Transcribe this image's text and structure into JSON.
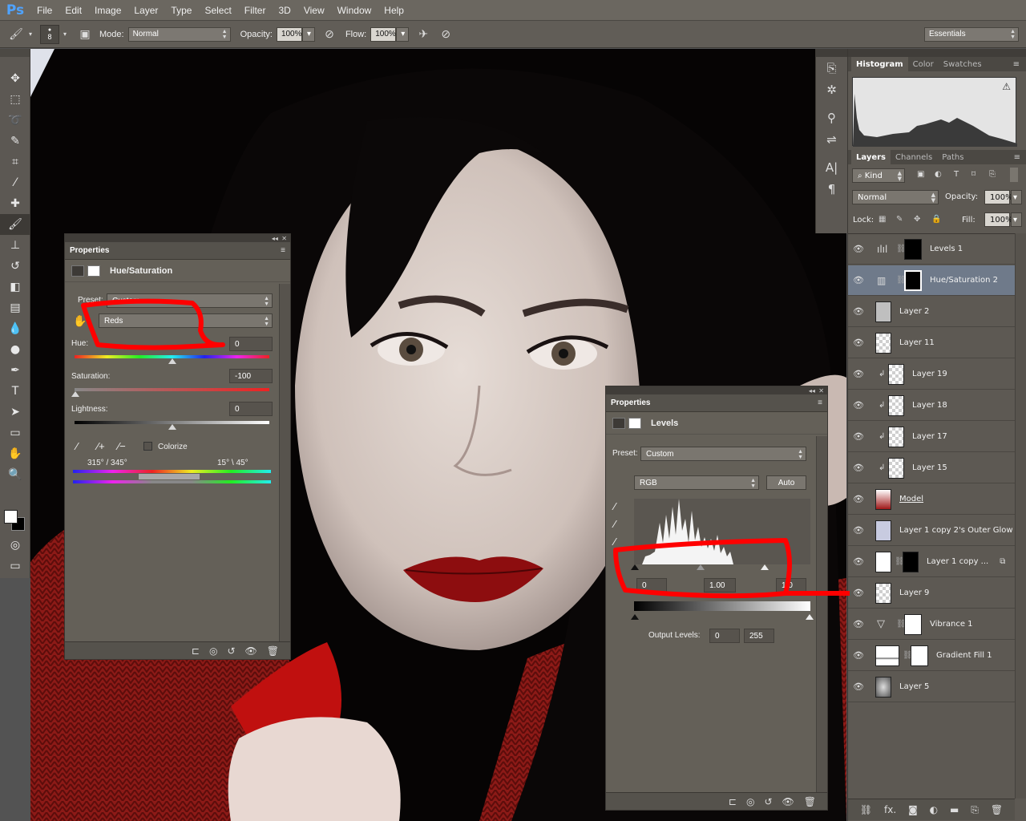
{
  "app": {
    "logo": "Ps"
  },
  "menu": [
    "File",
    "Edit",
    "Image",
    "Layer",
    "Type",
    "Select",
    "Filter",
    "3D",
    "View",
    "Window",
    "Help"
  ],
  "options": {
    "brush_size": "8",
    "mode_label": "Mode:",
    "mode_value": "Normal",
    "opacity_label": "Opacity:",
    "opacity_value": "100%",
    "flow_label": "Flow:",
    "flow_value": "100%",
    "workspace": "Essentials"
  },
  "hue_panel": {
    "title": "Properties",
    "adjustment": "Hue/Saturation",
    "preset_label": "Preset:",
    "preset_value": "Custom",
    "channel_value": "Reds",
    "hue_label": "Hue:",
    "hue_value": "0",
    "saturation_label": "Saturation:",
    "saturation_value": "-100",
    "lightness_label": "Lightness:",
    "lightness_value": "0",
    "colorize_label": "Colorize",
    "range_left": "315° / 345°",
    "range_right": "15° \\ 45°"
  },
  "levels_panel": {
    "title": "Properties",
    "adjustment": "Levels",
    "preset_label": "Preset:",
    "preset_value": "Custom",
    "channel_value": "RGB",
    "auto_label": "Auto",
    "input_black": "0",
    "input_mid": "1.00",
    "input_white": "1.0",
    "output_label": "Output Levels:",
    "output_black": "0",
    "output_white": "255"
  },
  "right_panel": {
    "histogram_tabs": [
      "Histogram",
      "Color",
      "Swatches"
    ],
    "layers_tabs": [
      "Layers",
      "Channels",
      "Paths"
    ],
    "kind_label": "Kind",
    "blend_mode": "Normal",
    "opacity_label": "Opacity:",
    "opacity_value": "100%",
    "lock_label": "Lock:",
    "fill_label": "Fill:",
    "fill_value": "100%"
  },
  "layers": [
    {
      "name": "Levels 1",
      "kind": "adjustment"
    },
    {
      "name": "Hue/Saturation 2",
      "kind": "adjustment",
      "selected": true
    },
    {
      "name": "Layer 2",
      "kind": "pixel"
    },
    {
      "name": "Layer 11",
      "kind": "pixel"
    },
    {
      "name": "Layer 19",
      "kind": "clipped"
    },
    {
      "name": "Layer 18",
      "kind": "clipped"
    },
    {
      "name": "Layer 17",
      "kind": "clipped"
    },
    {
      "name": "Layer 15",
      "kind": "clipped"
    },
    {
      "name": "Model",
      "kind": "pixel"
    },
    {
      "name": "Layer 1 copy 2's Outer Glow",
      "kind": "pixel"
    },
    {
      "name": "Layer 1 copy ...",
      "kind": "masked"
    },
    {
      "name": "Layer 9",
      "kind": "pixel"
    },
    {
      "name": "Vibrance 1",
      "kind": "adjustment"
    },
    {
      "name": "Gradient Fill 1",
      "kind": "fill"
    },
    {
      "name": "Layer 5",
      "kind": "pixel"
    }
  ]
}
